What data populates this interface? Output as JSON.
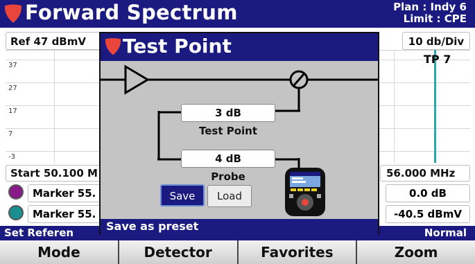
{
  "header": {
    "title": "Forward Spectrum",
    "plan_line": "Plan : Indy 6",
    "limit_line": "Limit : CPE"
  },
  "toolbar": {
    "ref_level": "Ref 47 dBmV",
    "scale": "10 db/Div"
  },
  "graph": {
    "y_labels": [
      "37",
      "27",
      "17",
      "7",
      "-3"
    ],
    "tp_label": "TP 7"
  },
  "freq": {
    "start": "Start 50.100 M",
    "stop": "56.000 MHz"
  },
  "markers": [
    {
      "label": "Marker 55.",
      "value": "0.0 dB",
      "color": "#8a1a8a"
    },
    {
      "label": "Marker 55.",
      "value": "-40.5 dBmV",
      "color": "#1a8f8f"
    }
  ],
  "status": {
    "left": "Set Referen",
    "right": "Normal"
  },
  "softkeys": [
    "Mode",
    "Detector",
    "Favorites",
    "Zoom"
  ],
  "modal": {
    "title": "Test Point",
    "test_point_value": "3 dB",
    "test_point_label": "Test Point",
    "probe_value": "4 dB",
    "probe_label": "Probe",
    "save_button": "Save",
    "load_button": "Load",
    "footer": "Save as preset"
  },
  "colors": {
    "header_bg": "#1a1a80",
    "logo_red": "#e8453c",
    "trace_teal": "#2aa8b0"
  }
}
